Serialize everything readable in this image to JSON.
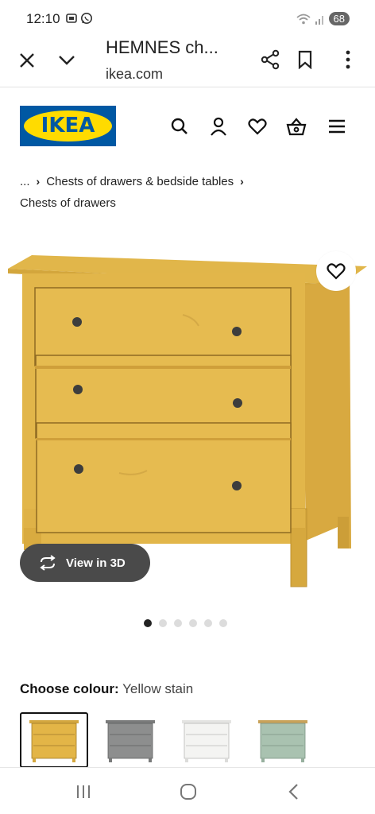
{
  "status": {
    "time": "12:10",
    "battery": "68"
  },
  "browser": {
    "title": "HEMNES ch...",
    "url": "ikea.com"
  },
  "header": {
    "logo_text": "IKEA",
    "brand_blue": "#0058a3",
    "brand_yellow": "#ffdb00",
    "icons": [
      "search-icon",
      "account-icon",
      "heart-icon",
      "basket-icon",
      "menu-icon"
    ]
  },
  "breadcrumb": {
    "ellipsis": "...",
    "separator": "›",
    "level1": "Chests of drawers & bedside tables",
    "current": "Chests of drawers"
  },
  "product": {
    "view3d_label": "View in 3D",
    "image_count": 6,
    "active_image": 1
  },
  "colour": {
    "label": "Choose colour:",
    "selected": "Yellow stain",
    "swatches": [
      {
        "name": "yellow stain",
        "color": "#e3b547"
      },
      {
        "name": "grey",
        "color": "#8d8e8e"
      },
      {
        "name": "white",
        "color": "#f1f1f0"
      },
      {
        "name": "green",
        "color": "#a9c2b0"
      }
    ]
  }
}
